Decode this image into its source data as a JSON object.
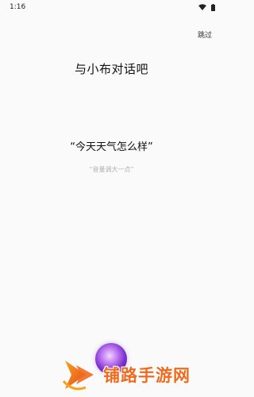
{
  "status_bar": {
    "time": "1:16",
    "wifi_icon": "wifi-icon",
    "battery_icon": "battery-icon"
  },
  "header": {
    "skip_label": "跳过"
  },
  "main": {
    "title": "与小布对话吧",
    "prompt": "“今天天气怎么样”",
    "hint": "“音量调大一点”"
  },
  "assistant": {
    "orb_icon": "voice-assistant-orb-icon"
  },
  "watermark": {
    "text": "铺路手游网",
    "color": "#f06a1e"
  }
}
